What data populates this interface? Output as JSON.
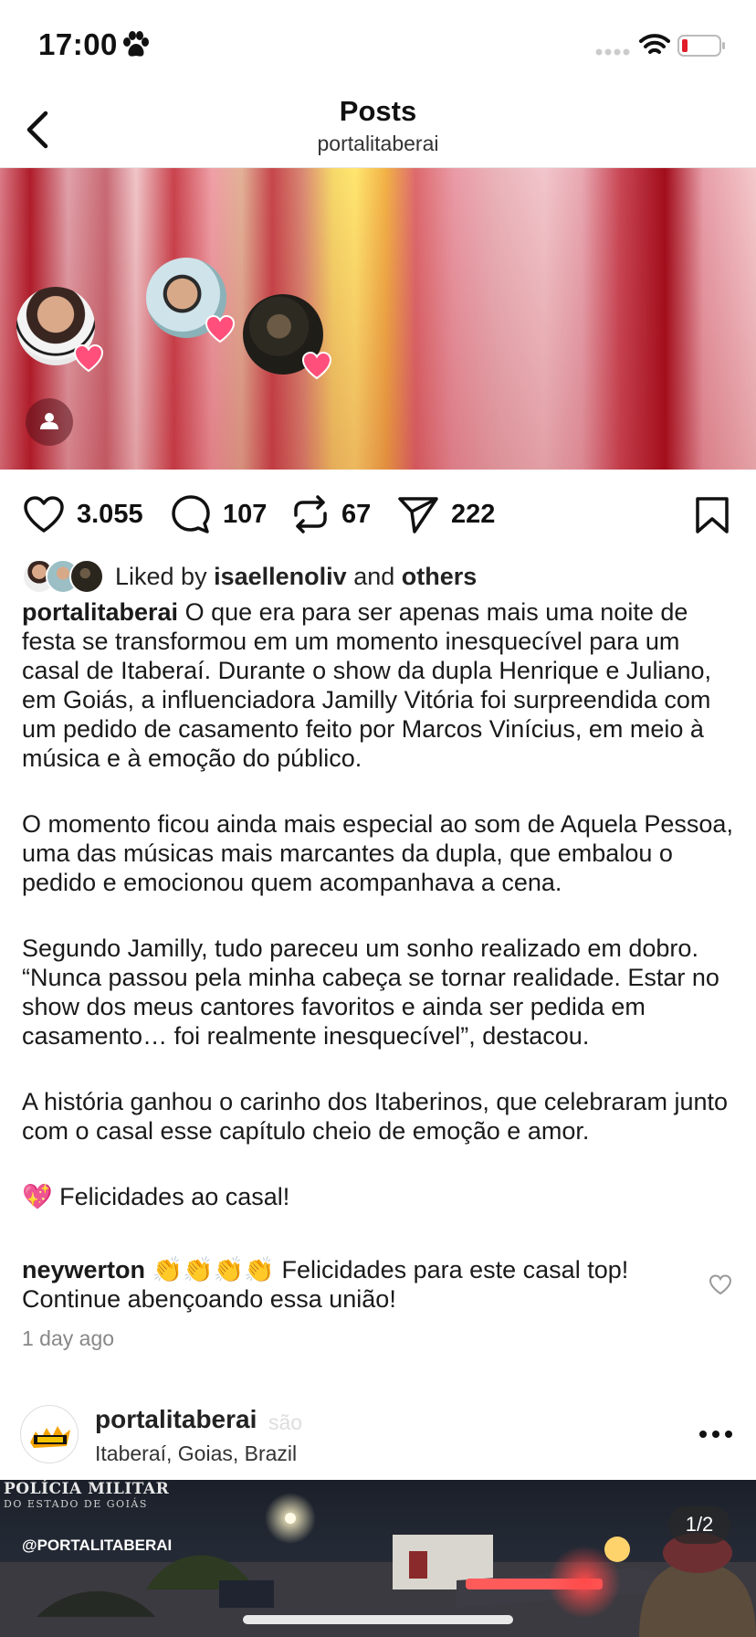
{
  "status_bar": {
    "time": "17:00"
  },
  "header": {
    "title": "Posts",
    "subtitle": "portalitaberai"
  },
  "post": {
    "actions": {
      "likes": "3.055",
      "comments": "107",
      "reposts": "67",
      "shares": "222"
    },
    "liked_by": {
      "prefix": "Liked by",
      "user": "isaellenoliv",
      "conjunction": "and",
      "others": "others"
    },
    "caption": {
      "user": "portalitaberai",
      "paragraph1": "O que era para ser apenas mais uma noite de festa se transformou em um momento inesquecível para um casal de Itaberaí. Durante o show da dupla Henrique e Juliano, em Goiás, a influenciadora Jamilly Vitória foi surpreendida com um pedido de casamento feito por Marcos Vinícius, em meio à música e à emoção do público.",
      "paragraph2": "O momento ficou ainda mais especial ao som de Aquela Pessoa, uma das músicas mais marcantes da dupla, que embalou o pedido e emocionou quem acompanhava a cena.",
      "paragraph3": "Segundo Jamilly, tudo pareceu um sonho realizado em dobro. “Nunca passou pela minha cabeça se tornar realidade. Estar no show dos meus cantores favoritos e ainda ser pedida em casamento… foi realmente inesquecível”, destacou.",
      "paragraph4": "A história ganhou o carinho dos Itaberinos, que celebraram junto com o casal esse capítulo cheio de emoção e amor.",
      "paragraph5": "💖 Felicidades ao casal!"
    },
    "top_comment": {
      "user": "neywerton",
      "text": "👏👏👏👏 Felicidades para este casal top! Continue abençoando essa união!"
    },
    "time_ago": "1 day ago"
  },
  "next_post": {
    "user": "portalitaberai",
    "ghost_text": "são",
    "location": "Itaberaí, Goias, Brazil",
    "watermark_line1": "POLÍCIA MILITAR",
    "watermark_line2": "DO ESTADO DE GOIÁS",
    "handle": "@PORTALITABERAI",
    "page_indicator": "1/2"
  },
  "colors": {
    "heart_badge": "#ff4f7a",
    "text_primary": "#111111",
    "text_secondary": "#888888"
  }
}
